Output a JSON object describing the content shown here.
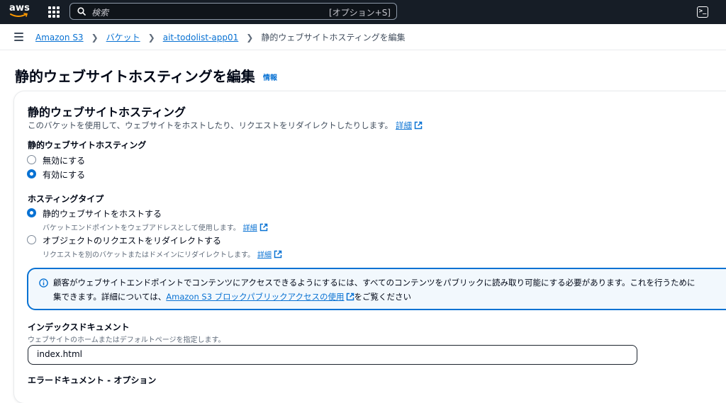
{
  "nav": {
    "logo_text": "aws",
    "search_placeholder": "検索",
    "search_shortcut": "[オプション+S]"
  },
  "breadcrumb": {
    "items": [
      "Amazon S3",
      "バケット",
      "ait-todolist-app01"
    ],
    "current": "静的ウェブサイトホスティングを編集"
  },
  "page": {
    "title": "静的ウェブサイトホスティングを編集",
    "info_link": "情報"
  },
  "section": {
    "title": "静的ウェブサイトホスティング",
    "description": "このバケットを使用して、ウェブサイトをホストしたり、リクエストをリダイレクトしたりします。",
    "detail_link": "詳細"
  },
  "hosting": {
    "label": "静的ウェブサイトホスティング",
    "options": [
      {
        "label": "無効にする",
        "selected": false
      },
      {
        "label": "有効にする",
        "selected": true
      }
    ]
  },
  "hosting_type": {
    "label": "ホスティングタイプ",
    "options": [
      {
        "label": "静的ウェブサイトをホストする",
        "sub": "バケットエンドポイントをウェブアドレスとして使用します。",
        "detail": "詳細",
        "selected": true
      },
      {
        "label": "オブジェクトのリクエストをリダイレクトする",
        "sub": "リクエストを別のバケットまたはドメインにリダイレクトします。",
        "detail": "詳細",
        "selected": false
      }
    ]
  },
  "alert": {
    "line1": "顧客がウェブサイトエンドポイントでコンテンツにアクセスできるようにするには、すべてのコンテンツをパブリックに読み取り可能にする必要があります。これを行うために",
    "line2_prefix": "集できます。詳細については、",
    "line2_link": "Amazon S3 ブロックパブリックアクセスの使用",
    "line2_suffix": "をご覧ください"
  },
  "index_document": {
    "label": "インデックスドキュメント",
    "hint": "ウェブサイトのホームまたはデフォルトページを指定します。",
    "value": "index.html"
  },
  "error_document": {
    "label": "エラードキュメント - オプション"
  },
  "colors": {
    "nav_bg": "#161d26",
    "link": "#0972d3",
    "alert_bg": "#f2f8fd"
  }
}
